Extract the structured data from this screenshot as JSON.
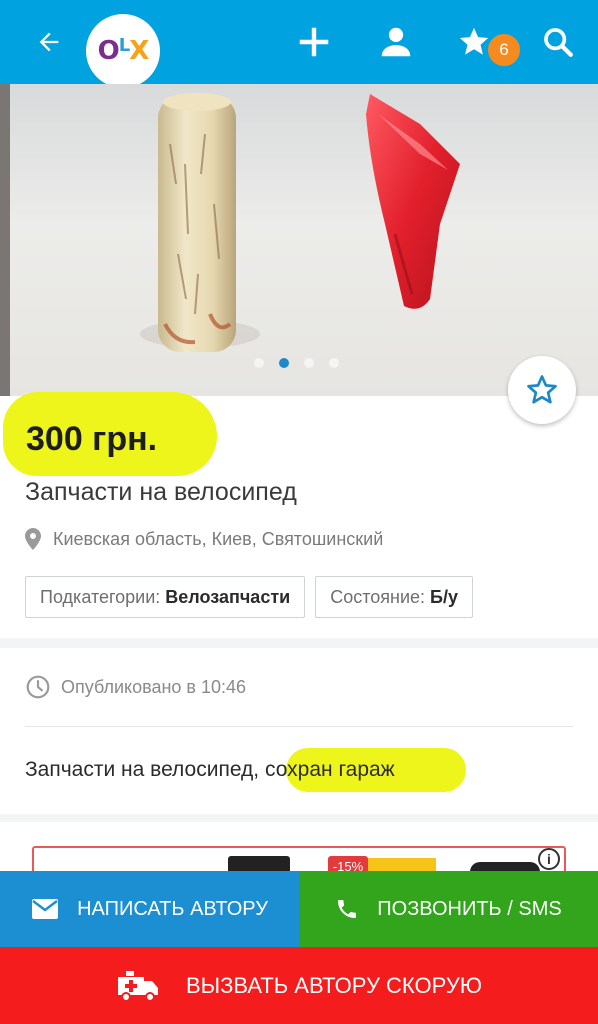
{
  "topbar": {
    "logo": "OLX",
    "icons": [
      "back-arrow-icon",
      "plus-icon",
      "user-icon",
      "star-icon",
      "search-icon"
    ],
    "favorites_count": "6",
    "bg_color": "#00a2e0"
  },
  "gallery": {
    "photo_count": 4,
    "active_index": 1
  },
  "listing": {
    "price": "300 грн.",
    "title": "Запчасти на велосипед",
    "location": "Киевская область, Киев, Святошинский",
    "chips": [
      {
        "label": "Подкатегории:",
        "value": "Велозапчасти"
      },
      {
        "label": "Состояние:",
        "value": "Б/у"
      }
    ]
  },
  "details": {
    "published": "Опубликовано в 10:46",
    "description_main": "Запчасти на велосипед, ",
    "description_highlight": "сохран гараж",
    "highlight_color": "#eef51a"
  },
  "ad": {
    "discount": "-15%",
    "info": "i"
  },
  "actions": {
    "write": "НАПИСАТЬ АВТОРУ",
    "call": "ПОЗВОНИТЬ / SMS",
    "ambulance": "ВЫЗВАТЬ АВТОРУ СКОРУЮ",
    "write_color": "#1c8ed2",
    "call_color": "#32a51c",
    "ambulance_color": "#f41c1c"
  }
}
